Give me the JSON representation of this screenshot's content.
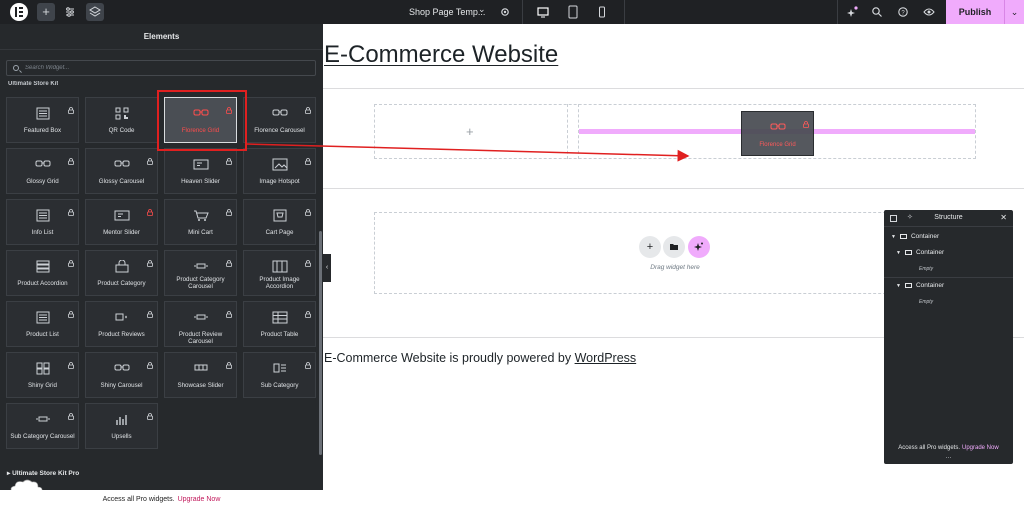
{
  "topbar": {
    "page_name": "Shop Page Temp...",
    "publish_label": "Publish",
    "colors": {
      "bg": "#1f2124",
      "publish": "#f0abfc"
    }
  },
  "panel": {
    "title": "Elements",
    "search_placeholder": "Search Widget...",
    "category_partial": "Ultimate Store Kit",
    "pro_category": "Ultimate Store Kit Pro",
    "footer_text": "Access all Pro widgets.",
    "footer_link": "Upgrade Now",
    "widgets": [
      {
        "label": "Featured Box",
        "icon": "list-icon",
        "lock": "white"
      },
      {
        "label": "QR Code",
        "icon": "qr-code-icon",
        "lock": "none"
      },
      {
        "label": "Florence Grid",
        "icon": "eyeglasses-icon",
        "lock": "red"
      },
      {
        "label": "Florence Carousel",
        "icon": "eyeglasses-icon",
        "lock": "white"
      },
      {
        "label": "Glossy Grid",
        "icon": "eyeglasses-icon",
        "lock": "white"
      },
      {
        "label": "Glossy Carousel",
        "icon": "eyeglasses-icon",
        "lock": "white"
      },
      {
        "label": "Heaven Slider",
        "icon": "slider-icon",
        "lock": "white"
      },
      {
        "label": "Image Hotspot",
        "icon": "image-icon",
        "lock": "white"
      },
      {
        "label": "Info List",
        "icon": "list-icon",
        "lock": "white"
      },
      {
        "label": "Mentor Slider",
        "icon": "slider-icon",
        "lock": "red"
      },
      {
        "label": "Mini Cart",
        "icon": "cart-icon",
        "lock": "white"
      },
      {
        "label": "Cart Page",
        "icon": "cart-page-icon",
        "lock": "white"
      },
      {
        "label": "Product Accordion",
        "icon": "accordion-icon",
        "lock": "white"
      },
      {
        "label": "Product Category",
        "icon": "bag-icon",
        "lock": "white"
      },
      {
        "label": "Product Category Carousel",
        "icon": "carousel-icon",
        "lock": "white"
      },
      {
        "label": "Product Image Accordion",
        "icon": "image-accordion-icon",
        "lock": "white"
      },
      {
        "label": "Product List",
        "icon": "list-icon",
        "lock": "white"
      },
      {
        "label": "Product Reviews",
        "icon": "reviews-icon",
        "lock": "white"
      },
      {
        "label": "Product Review Carousel",
        "icon": "carousel-icon",
        "lock": "white"
      },
      {
        "label": "Product Table",
        "icon": "table-icon",
        "lock": "white"
      },
      {
        "label": "Shiny Grid",
        "icon": "grid-icon",
        "lock": "white"
      },
      {
        "label": "Shiny Carousel",
        "icon": "eyeglasses-icon",
        "lock": "white"
      },
      {
        "label": "Showcase Slider",
        "icon": "showcase-icon",
        "lock": "white"
      },
      {
        "label": "Sub Category",
        "icon": "sub-category-icon",
        "lock": "white"
      },
      {
        "label": "Sub Category Carousel",
        "icon": "carousel-icon",
        "lock": "white"
      },
      {
        "label": "Upsells",
        "icon": "chart-icon",
        "lock": "white"
      }
    ]
  },
  "canvas": {
    "site_title": "E-Commerce Website",
    "ghost_label": "Florence Grid",
    "drag_hint": "Drag widget here",
    "footer_text": "E-Commerce Website is proudly powered by",
    "footer_link": "WordPress"
  },
  "structure": {
    "title": "Structure",
    "items": [
      {
        "label": "Container"
      },
      {
        "label": "Container",
        "empty": "Empty"
      },
      {
        "label": "Container",
        "empty": "Empty"
      }
    ],
    "footer_text": "Access all Pro widgets.",
    "footer_link": "Upgrade Now"
  }
}
